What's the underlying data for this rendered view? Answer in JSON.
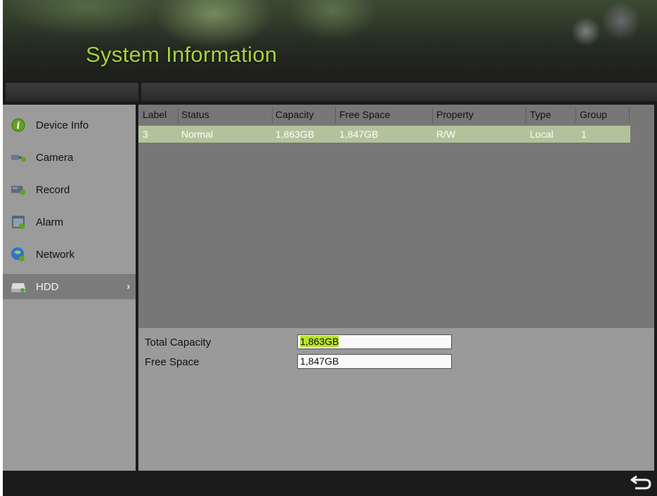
{
  "window": {
    "title": "System Information"
  },
  "nav": {
    "items": [
      {
        "label": "Device Info",
        "icon": "info-icon"
      },
      {
        "label": "Camera",
        "icon": "camera-icon"
      },
      {
        "label": "Record",
        "icon": "record-icon"
      },
      {
        "label": "Alarm",
        "icon": "alarm-icon"
      },
      {
        "label": "Network",
        "icon": "network-icon"
      },
      {
        "label": "HDD",
        "icon": "hdd-icon",
        "selected": true
      }
    ]
  },
  "hdd_table": {
    "columns": [
      "Label",
      "Status",
      "Capacity",
      "Free Space",
      "Property",
      "Type",
      "Group"
    ],
    "rows": [
      {
        "label": "3",
        "status": "Normal",
        "capacity": "1,863GB",
        "free_space": "1,847GB",
        "property": "R/W",
        "type": "Local",
        "group": "1"
      }
    ]
  },
  "summary": {
    "total_capacity_label": "Total Capacity",
    "total_capacity_value": "1,863GB",
    "free_space_label": "Free Space",
    "free_space_value": "1,847GB"
  },
  "footer": {
    "back_icon": "back-arrow-icon"
  },
  "colors": {
    "accent": "#a5d23f",
    "selection_row": "#b2c39b",
    "highlight": "#b8e22d"
  }
}
